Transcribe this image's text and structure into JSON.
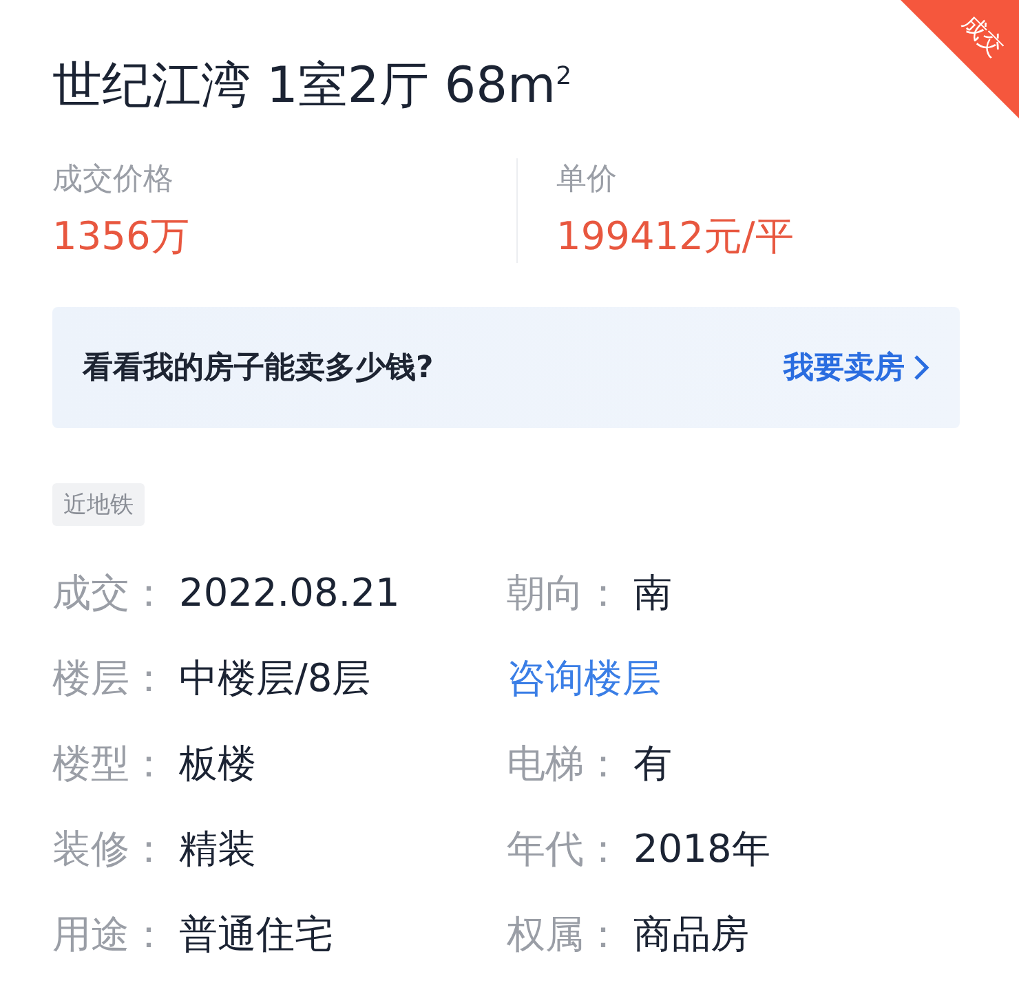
{
  "ribbon": {
    "text": "成交"
  },
  "title": "世纪江湾 1室2厅 68m$^{2}$",
  "prices": [
    {
      "label": "成交价格",
      "value": "1356万"
    },
    {
      "label": "单价",
      "value": "199412元/平"
    }
  ],
  "banner": {
    "text": "看看我的房子能卖多少钱?",
    "action": "我要卖房"
  },
  "tags": [
    "近地铁"
  ],
  "details": [
    {
      "kind": "field",
      "label": "成交：",
      "value": "2022.08.21"
    },
    {
      "kind": "field",
      "label": "朝向：",
      "value": "南"
    },
    {
      "kind": "field",
      "label": "楼层：",
      "value": "中楼层/8层"
    },
    {
      "kind": "link",
      "value": "咨询楼层"
    },
    {
      "kind": "field",
      "label": "楼型：",
      "value": "板楼"
    },
    {
      "kind": "field",
      "label": "电梯：",
      "value": "有"
    },
    {
      "kind": "field",
      "label": "装修：",
      "value": "精装"
    },
    {
      "kind": "field",
      "label": "年代：",
      "value": "2018年"
    },
    {
      "kind": "field",
      "label": "用途：",
      "value": "普通住宅"
    },
    {
      "kind": "field",
      "label": "权属：",
      "value": "商品房"
    }
  ]
}
